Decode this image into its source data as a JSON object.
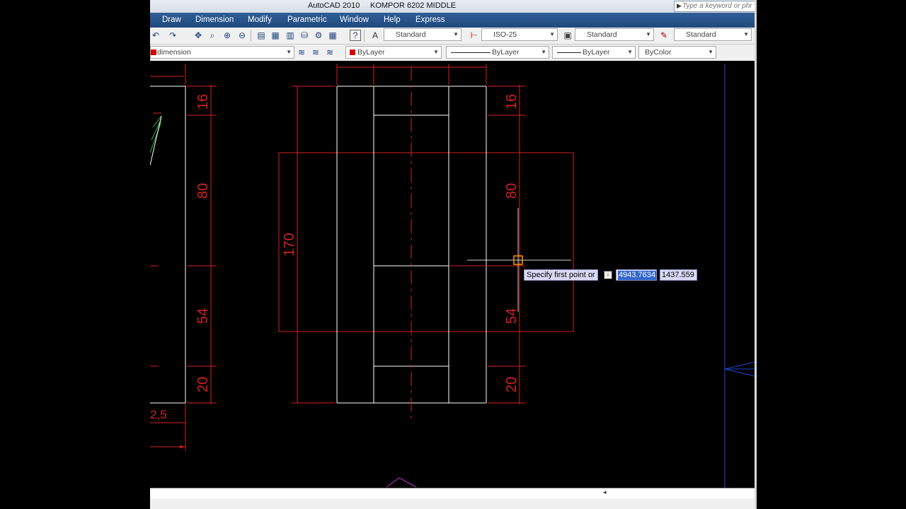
{
  "titlebar": {
    "app_name": "AutoCAD 2010",
    "file_name": "KOMPOR 6202 MIDDLE",
    "search_placeholder": "Type a keyword or phr"
  },
  "menu": [
    "Draw",
    "Dimension",
    "Modify",
    "Parametric",
    "Window",
    "Help",
    "Express"
  ],
  "toolbar_styles": {
    "text_style": "Standard",
    "dim_style": "ISO-25",
    "table_style": "Standard",
    "multileader_style": "Standard"
  },
  "layers_toolbar": {
    "current_layer": "dimension",
    "color": "ByLayer",
    "linetype": "ByLayer",
    "lineweight": "ByLayer",
    "plot_style": "ByColor",
    "layer_color": "#d40000"
  },
  "drawing": {
    "left_dims": [
      "16",
      "80",
      "54",
      "20"
    ],
    "left_bottom_dim": "2,5",
    "center_height_dim": "170",
    "right_dims": [
      "16",
      "80",
      "54",
      "20"
    ],
    "colors": {
      "dimension": "#d42020",
      "geometry": "#ffffff",
      "hatch": "#2fb24a",
      "blue_line": "#2244cc",
      "crosshair_box": "#ff9a00"
    }
  },
  "command_tooltip": {
    "prompt": "Specify first point or",
    "x_value": "4943.7634",
    "y_value": "1437.559"
  }
}
